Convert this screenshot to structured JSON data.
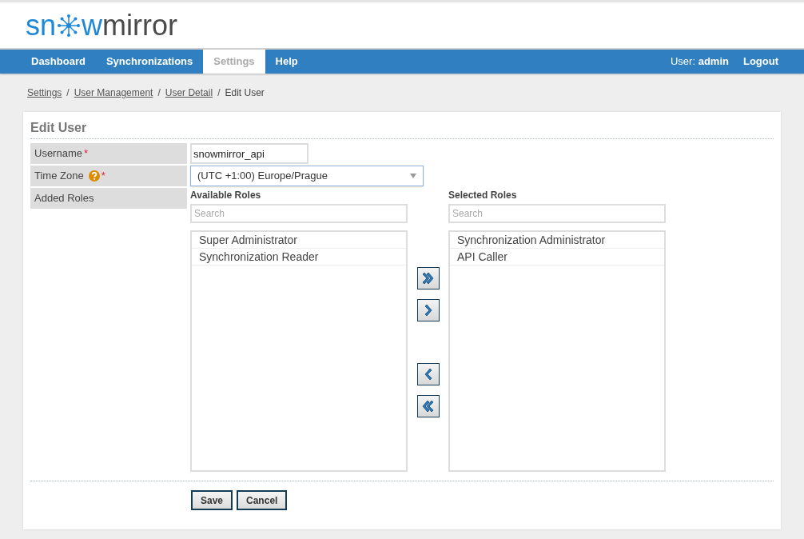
{
  "logo": {
    "part_1": "sn",
    "part_2": "w",
    "part_3": "mirror"
  },
  "nav": {
    "items": [
      {
        "label": "Dashboard",
        "selected": false
      },
      {
        "label": "Synchronizations",
        "selected": false
      },
      {
        "label": "Settings",
        "selected": true
      },
      {
        "label": "Help",
        "selected": false
      }
    ],
    "user_label": "User:",
    "user_name": "admin",
    "logout": "Logout"
  },
  "breadcrumb": {
    "links": [
      "Settings",
      "User Management",
      "User Detail"
    ],
    "separator": "/",
    "current": "Edit User"
  },
  "form": {
    "title": "Edit User",
    "fields": [
      {
        "label": "Username",
        "required": true,
        "help": false,
        "kind": "text",
        "value": "snowmirror_api"
      },
      {
        "label": "Time Zone",
        "required": true,
        "help": true,
        "kind": "select",
        "value": "(UTC +1:00) Europe/Prague"
      },
      {
        "label": "Added Roles",
        "required": false,
        "help": false,
        "kind": "roles"
      }
    ],
    "required_mark": "*",
    "available": {
      "heading": "Available Roles",
      "placeholder": "Search",
      "items": [
        "Super Administrator",
        "Synchronization Reader"
      ]
    },
    "selected": {
      "heading": "Selected Roles",
      "placeholder": "Search",
      "items": [
        "Synchronization Administrator",
        "API Caller"
      ]
    },
    "transfer_buttons": [
      {
        "kind": "add_all"
      },
      {
        "kind": "add"
      },
      {
        "kind": "remove"
      },
      {
        "kind": "remove_all"
      }
    ],
    "buttons": [
      "Save",
      "Cancel"
    ]
  }
}
